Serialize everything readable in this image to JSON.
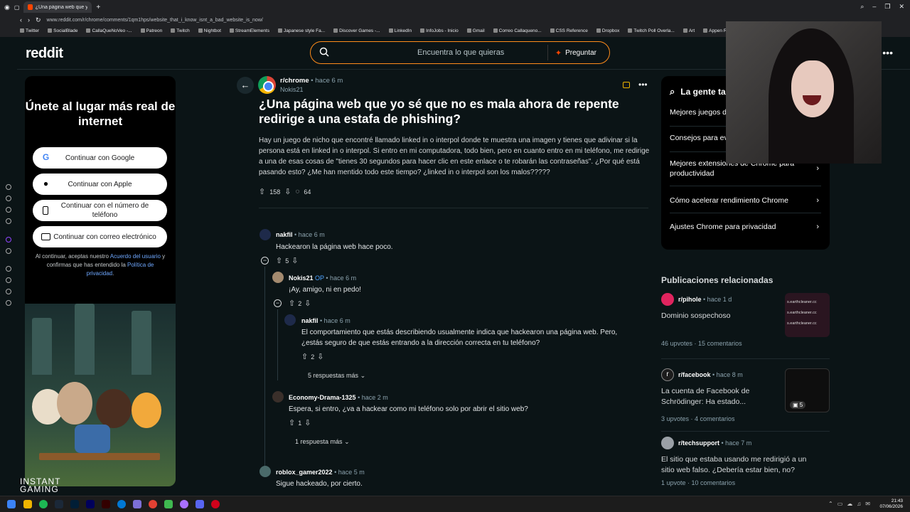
{
  "browser": {
    "tab_title": "¿Una página web que yo sé...",
    "url": "www.reddit.com/r/chrome/comments/1qm1hps/website_that_i_know_isnt_a_bad_website_is_now/",
    "bookmarks": [
      "Twitter",
      "SocialBlade",
      "CallaQueNoVeo -...",
      "Patreon",
      "Twitch",
      "Nightbot",
      "StreamElements",
      "Japanese style Fa...",
      "Discover Games -...",
      "LinkedIn",
      "InfoJobs - Inicio",
      "Gmail",
      "Correo Callaqueno...",
      "CSS Reference",
      "Dropbox",
      "Twitch Poll Overla...",
      "Art",
      "Appen Register"
    ]
  },
  "header": {
    "logo": "reddit",
    "search_placeholder": "Encuentra lo que quieras",
    "ask_label": "Preguntar"
  },
  "left_card": {
    "heading": "Únete al lugar más real de internet",
    "google": "Continuar con Google",
    "apple": "Continuar con Apple",
    "phone": "Continuar con el número de teléfono",
    "email": "Continuar con correo electrónico",
    "legal_pre": "Al continuar, aceptas nuestro ",
    "legal_link1": "Acuerdo del usuario",
    "legal_mid": " y confirmas que has entendido la ",
    "legal_link2": "Política de privacidad",
    "legal_post": "."
  },
  "post": {
    "subreddit": "r/chrome",
    "time": "• hace 6 m",
    "author": "Nokis21",
    "title": "¿Una página web que yo sé que no es mala ahora de repente redirige a una estafa de phishing?",
    "body": "Hay un juego de nicho que encontré llamado linked in o interpol donde te muestra una imagen y tienes que adivinar si la persona está en linked in o interpol. Si entro en mi computadora, todo bien, pero en cuanto entro en mi teléfono, me redirige a una de esas cosas de \"tienes 30 segundos para hacer clic en este enlace o te robarán las contraseñas\". ¿Por qué está pasando esto? ¿Me han mentido todo este tiempo? ¿linked in o interpol son los malos?????",
    "upvotes": "158",
    "comments": "64"
  },
  "comments": [
    {
      "user": "nakfil",
      "op": "",
      "time": "• hace 6 m",
      "text": "Hackearon la página web hace poco.",
      "votes": "5"
    },
    {
      "user": "Nokis21",
      "op": "OP",
      "time": "• hace 6 m",
      "text": "¡Ay, amigo, ni en pedo!",
      "votes": "2"
    },
    {
      "user": "nakfil",
      "op": "",
      "time": "• hace 6 m",
      "text": "El comportamiento que estás describiendo usualmente indica que hackearon una página web. Pero, ¿estás seguro de que estás entrando a la dirección correcta en tu teléfono?",
      "votes": "2"
    },
    {
      "user": "Economy-Drama-1325",
      "op": "",
      "time": "• hace 2 m",
      "text": "Espera, si entro, ¿va a hackear como mi teléfono solo por abrir el sitio web?",
      "votes": "1"
    },
    {
      "user": "roblox_gamer2022",
      "op": "",
      "time": "• hace 5 m",
      "text": "Sigue hackeado, por cierto.",
      "votes": ""
    }
  ],
  "more_replies": [
    "5 respuestas más",
    "1 respuesta más"
  ],
  "right_card": {
    "heading": "La gente ta",
    "items": [
      "Mejores juegos d",
      "Consejos para ev",
      "Mejores extensiones de Chrome para productividad",
      "Cómo acelerar rendimiento Chrome",
      "Ajustes Chrome para privacidad"
    ]
  },
  "related": {
    "heading": "Publicaciones relacionadas",
    "posts": [
      {
        "sub": "r/pihole",
        "time": "• hace 1 d",
        "title": "Dominio sospechoso",
        "upvotes": "46 upvotes",
        "comments": "15 comentarios",
        "thumb_text": "s.earthcleaner.cc",
        "color": "#e0245e"
      },
      {
        "sub": "r/facebook",
        "time": "• hace 8 m",
        "title": "La cuenta de Facebook de Schrödinger: Ha estado...",
        "upvotes": "3 upvotes",
        "comments": "4 comentarios",
        "thumb_badge": "5",
        "color": "#1c1c1c"
      },
      {
        "sub": "r/techsupport",
        "time": "• hace 7 m",
        "title": "El sitio que estaba usando me redirigió a un sitio web falso. ¿Debería estar bien, no?",
        "upvotes": "1 upvote",
        "comments": "10 comentarios",
        "color": "#9aa0a6"
      }
    ]
  },
  "overlay": {
    "brand": "INSTANT GAMING"
  },
  "taskbar": {
    "time": "21:43",
    "date": "07/06/2026"
  }
}
